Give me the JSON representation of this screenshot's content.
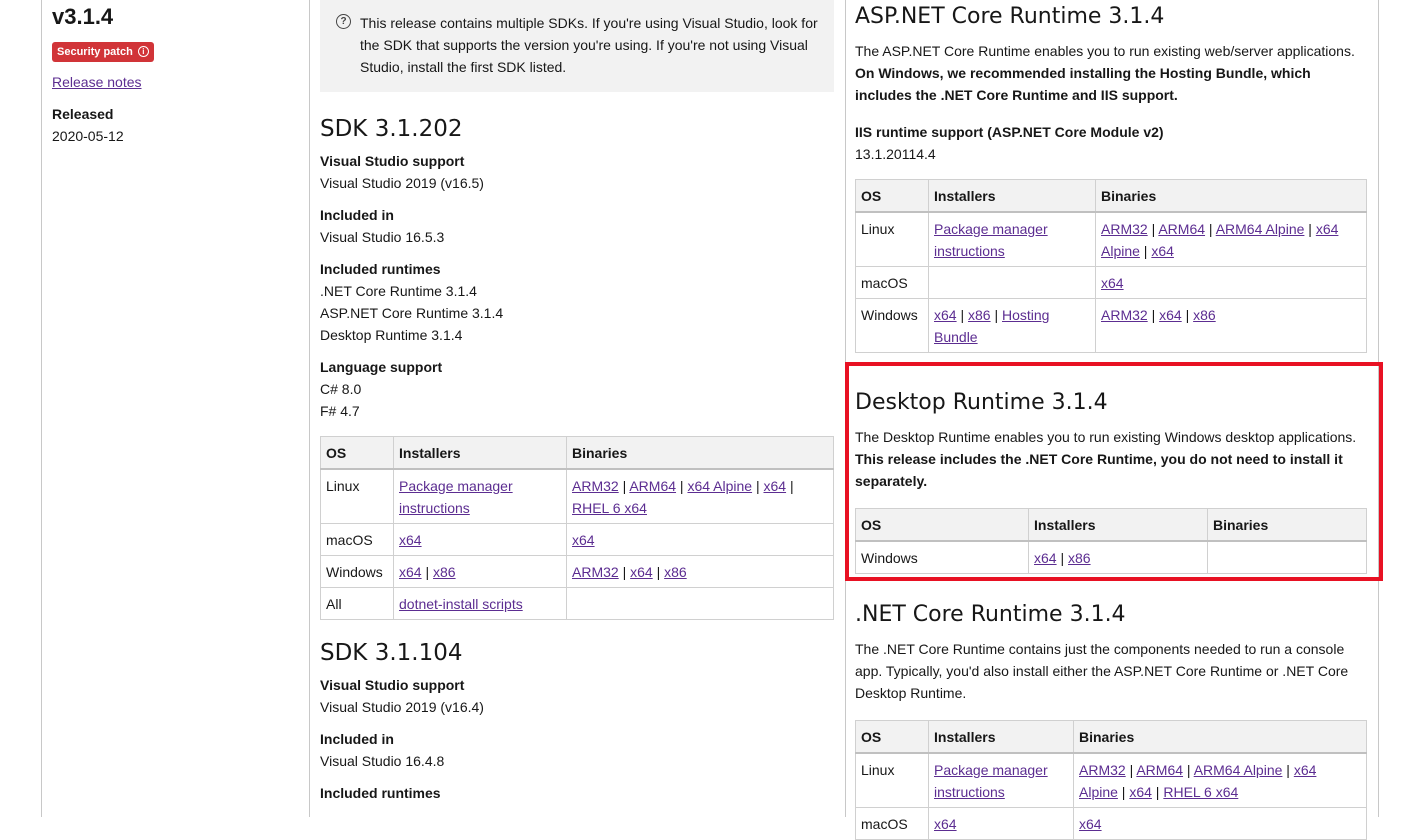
{
  "release": {
    "version": "v3.1.4",
    "badge": "Security patch",
    "release_notes": "Release notes",
    "released_label": "Released",
    "released_date": "2020-05-12"
  },
  "note": "This release contains multiple SDKs. If you're using Visual Studio, look for the SDK that supports the version you're using. If you're not using Visual Studio, install the first SDK listed.",
  "sdk1": {
    "title": "SDK 3.1.202",
    "vs_label": "Visual Studio support",
    "vs_value": "Visual Studio 2019 (v16.5)",
    "incl_label": "Included in",
    "incl_value": "Visual Studio 16.5.3",
    "rt_label": "Included runtimes",
    "rt1": ".NET Core Runtime 3.1.4",
    "rt2": "ASP.NET Core Runtime 3.1.4",
    "rt3": "Desktop Runtime 3.1.4",
    "lang_label": "Language support",
    "lang1": "C# 8.0",
    "lang2": "F# 4.7"
  },
  "table_headers": {
    "os": "OS",
    "installers": "Installers",
    "binaries": "Binaries"
  },
  "os": {
    "linux": "Linux",
    "macos": "macOS",
    "windows": "Windows",
    "all": "All"
  },
  "links": {
    "pkg1": "Package manager",
    "pkg2": "instructions",
    "arm32": "ARM32",
    "arm64": "ARM64",
    "x64_alpine": "x64 Alpine",
    "x64": "x64",
    "rhel": "RHEL 6 x64",
    "x86": "x86",
    "dotnet_install": "dotnet-install scripts",
    "arm64_alpine": "ARM64 Alpine",
    "x64_al1": "x64",
    "x64_al2": "Alpine",
    "hosting1": "Hosting",
    "hosting2": "Bundle"
  },
  "sdk2": {
    "title": "SDK 3.1.104",
    "vs_label": "Visual Studio support",
    "vs_value": "Visual Studio 2019 (v16.4)",
    "incl_label": "Included in",
    "incl_value": "Visual Studio 16.4.8",
    "rt_label": "Included runtimes"
  },
  "aspnet": {
    "title": "ASP.NET Core Runtime 3.1.4",
    "desc_plain": "The ASP.NET Core Runtime enables you to run existing web/server applications. ",
    "desc_bold": "On Windows, we recommended installing the Hosting Bundle, which includes the .NET Core Runtime and IIS support.",
    "iis_label": "IIS runtime support (ASP.NET Core Module v2)",
    "iis_value": "13.1.20114.4"
  },
  "desktop": {
    "title": "Desktop Runtime 3.1.4",
    "desc_plain": "The Desktop Runtime enables you to run existing Windows desktop applications. ",
    "desc_bold": "This release includes the .NET Core Runtime, you do not need to install it separately."
  },
  "netcore": {
    "title": ".NET Core Runtime 3.1.4",
    "desc": "The .NET Core Runtime contains just the components needed to run a console app. Typically, you'd also install either the ASP.NET Core Runtime or .NET Core Desktop Runtime."
  },
  "colors": {
    "link": "#5c2d91",
    "badge": "#d13438",
    "highlight": "#e81123",
    "note_bg": "#f2f2f2"
  }
}
